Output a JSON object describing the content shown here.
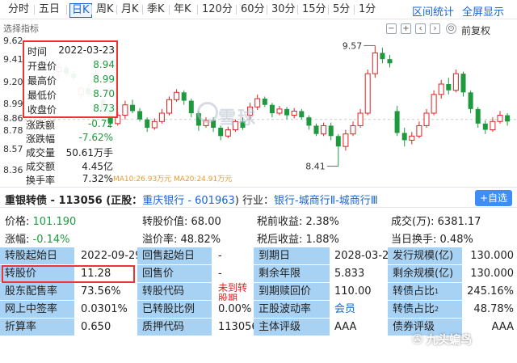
{
  "tabs": {
    "items": [
      "分时",
      "五日",
      "日K",
      "周K",
      "月K",
      "季K",
      "年K",
      "120分",
      "60分",
      "30分",
      "15分",
      "5分",
      "1分"
    ],
    "active": "日K",
    "links": [
      "区间统计",
      "全屏显示"
    ]
  },
  "chart_header": {
    "indicator_label": "选择指标",
    "adjust_label": "前复权",
    "controls": [
      "−",
      "+",
      "‹",
      "›",
      "⊙"
    ]
  },
  "chart": {
    "y_labels": [
      "9.62",
      "9.41",
      "9.20",
      "8.99",
      "8.86",
      "8.78",
      "8.57",
      "8.36"
    ],
    "high_marker": "9.57",
    "low_marker": "8.41",
    "ma_strip": "MA10:26.93万元   MA20:24.91万元",
    "watermark": "雪球"
  },
  "info_panel": {
    "rows": [
      {
        "k": "时间",
        "v": "2022-03-23",
        "color": "normal"
      },
      {
        "k": "开盘价",
        "v": "8.94",
        "color": "green"
      },
      {
        "k": "最高价",
        "v": "8.99",
        "color": "green"
      },
      {
        "k": "最低价",
        "v": "8.70",
        "color": "green"
      },
      {
        "k": "收盘价",
        "v": "8.73",
        "color": "green"
      }
    ],
    "extra": [
      {
        "k": "涨跌额",
        "v": "-0.72",
        "color": "green"
      },
      {
        "k": "涨跌幅",
        "v": "-7.62%",
        "color": "green"
      },
      {
        "k": "成交量",
        "v": "50.61万手",
        "color": "normal"
      },
      {
        "k": "成交额",
        "v": "4.45亿",
        "color": "normal"
      },
      {
        "k": "换手率",
        "v": "7.32%",
        "color": "normal"
      }
    ]
  },
  "bond": {
    "title": "重银转债 - 113056 (正股：",
    "stock": "重庆银行 - 601963",
    "industry_label": ")  行业：",
    "industry": "银行-城商行Ⅱ-城商行Ⅲ",
    "add_label": "+自选"
  },
  "quote": {
    "row1": [
      {
        "k": "价格: ",
        "v": "101.190",
        "color": "green"
      },
      {
        "k": "转股价值: ",
        "v": "68.00",
        "color": "normal"
      },
      {
        "k": "税前收益: ",
        "v": "2.38%",
        "color": "normal"
      },
      {
        "k": "成交(万): ",
        "v": "6381.17",
        "color": "normal"
      }
    ],
    "row2": [
      {
        "k": "涨幅: ",
        "v": "-0.14%",
        "color": "green"
      },
      {
        "k": "溢价率: ",
        "v": "48.82%",
        "color": "normal"
      },
      {
        "k": "税后收益: ",
        "v": "1.88%",
        "color": "normal"
      },
      {
        "k": "当日换手: ",
        "v": "0.48%",
        "color": "normal"
      }
    ]
  },
  "grid": {
    "rows": [
      [
        {
          "t": "转股起始日",
          "lab": true
        },
        {
          "t": "2022-09-29"
        },
        {
          "t": "回售起始日",
          "lab": true
        },
        {
          "t": "-"
        },
        {
          "t": "到期日",
          "lab": true
        },
        {
          "t": "2028-03-22"
        },
        {
          "t": "发行规模(亿)",
          "lab": true
        },
        {
          "t": "130.000"
        }
      ],
      [
        {
          "t": "转股价",
          "lab": true
        },
        {
          "t": "11.28"
        },
        {
          "t": "回售价",
          "lab": true
        },
        {
          "t": "-"
        },
        {
          "t": "剩余年限",
          "lab": true
        },
        {
          "t": "5.833"
        },
        {
          "t": "剩余规模(亿)",
          "lab": true
        },
        {
          "t": "130.000"
        }
      ],
      [
        {
          "t": "股东配售率",
          "lab": true
        },
        {
          "t": "73.56%"
        },
        {
          "t": "转股代码",
          "lab": true
        },
        {
          "t": "未到转股期",
          "red": true
        },
        {
          "t": "到期赎回价",
          "lab": true
        },
        {
          "t": "110.00"
        },
        {
          "t": "转债占比",
          "sup": "1",
          "lab": true
        },
        {
          "t": "245.16%"
        }
      ],
      [
        {
          "t": "网上中签率",
          "lab": true
        },
        {
          "t": "0.0301%"
        },
        {
          "t": "已转股比例",
          "lab": true
        },
        {
          "t": "0.00%"
        },
        {
          "t": "正股波动率",
          "lab": true
        },
        {
          "t": "会员",
          "blue": true
        },
        {
          "t": "转债占比",
          "sup": "2",
          "lab": true
        },
        {
          "t": "48.78%"
        }
      ],
      [
        {
          "t": "折算率",
          "lab": true
        },
        {
          "t": "0.650"
        },
        {
          "t": "质押代码",
          "lab": true
        },
        {
          "t": "113056"
        },
        {
          "t": "主体评级",
          "lab": true
        },
        {
          "t": "AAA"
        },
        {
          "t": "债券评级",
          "lab": true
        },
        {
          "t": "AAA"
        }
      ]
    ]
  },
  "brand": "九头蝙鸟",
  "colors": {
    "up": "#e22222",
    "down": "#1e9a3e",
    "accent": "#1a64d6",
    "label_bg": "#a8d2f4"
  }
}
